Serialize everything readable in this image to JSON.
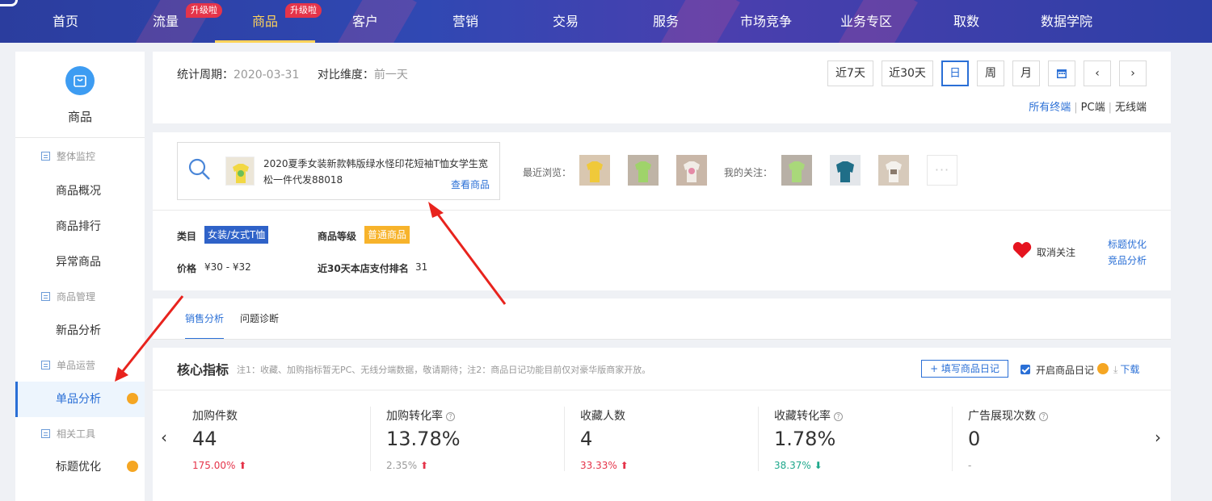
{
  "topnav": {
    "items": [
      {
        "label": "首页"
      },
      {
        "label": "流量",
        "badge": "升级啦"
      },
      {
        "label": "商品",
        "badge": "升级啦",
        "active": true
      },
      {
        "label": "客户"
      },
      {
        "label": "营销"
      },
      {
        "label": "交易"
      },
      {
        "label": "服务"
      },
      {
        "label": "市场竞争"
      },
      {
        "label": "业务专区"
      },
      {
        "label": "取数"
      },
      {
        "label": "数据学院"
      }
    ]
  },
  "sidebar": {
    "icon": "shopping-bag-icon",
    "title": "商品",
    "groups": [
      {
        "label": "整体监控"
      },
      {
        "label": "商品管理"
      },
      {
        "label": "单品运营"
      },
      {
        "label": "相关工具"
      }
    ],
    "links": [
      {
        "label": "商品概况"
      },
      {
        "label": "商品排行"
      },
      {
        "label": "异常商品"
      },
      {
        "label": "新品分析"
      },
      {
        "label": "单品分析",
        "active": true
      },
      {
        "label": "标题优化"
      }
    ]
  },
  "period": {
    "stat_label": "统计周期：",
    "stat_value": "2020-03-31",
    "compare_label": "对比维度：",
    "compare_value": "前一天",
    "buttons": [
      "近7天",
      "近30天",
      "日",
      "周",
      "月"
    ],
    "selected": "日",
    "terminals": [
      "所有终端",
      "PC端",
      "无线端"
    ],
    "selected_terminal": "所有终端"
  },
  "product": {
    "name": "2020夏季女装新款韩版绿水怪印花短袖T恤女学生宽松一件代发88018",
    "view_link": "查看商品",
    "recent_label": "最近浏览：",
    "follow_label": "我的关注：",
    "more": "···",
    "category_label": "类目",
    "category_value": "女装/女式T恤",
    "grade_label": "商品等级",
    "grade_value": "普通商品",
    "price_label": "价格",
    "price_value": "¥30 - ¥32",
    "rank_label": "近30天本店支付排名",
    "rank_value": "31",
    "unfollow": "取消关注",
    "link1": "标题优化",
    "link2": "竞品分析"
  },
  "tabs": [
    "销售分析",
    "问题诊断"
  ],
  "core": {
    "title": "核心指标",
    "note": "注1：收藏、加购指标暂无PC、无线分端数据，敬请期待；注2：商品日记功能目前仅对豪华版商家开放。",
    "diary_button": "+ 填写商品日记",
    "diary_toggle": "开启商品日记",
    "download": "下载",
    "metrics": [
      {
        "label": "加购件数",
        "value": "44",
        "change": "175.00%",
        "trend": "up",
        "help": false
      },
      {
        "label": "加购转化率",
        "value": "13.78%",
        "change": "2.35%",
        "trend": "up",
        "help": true
      },
      {
        "label": "收藏人数",
        "value": "4",
        "change": "33.33%",
        "trend": "up",
        "help": false
      },
      {
        "label": "收藏转化率",
        "value": "1.78%",
        "change": "38.37%",
        "trend": "down",
        "help": true
      },
      {
        "label": "广告展现次数",
        "value": "0",
        "change": "-",
        "trend": "flat",
        "help": true
      }
    ]
  },
  "colors": {
    "accent": "#2a6fd6",
    "up": "#e5344a",
    "down": "#1fa88c",
    "badge": "#f5a623"
  }
}
